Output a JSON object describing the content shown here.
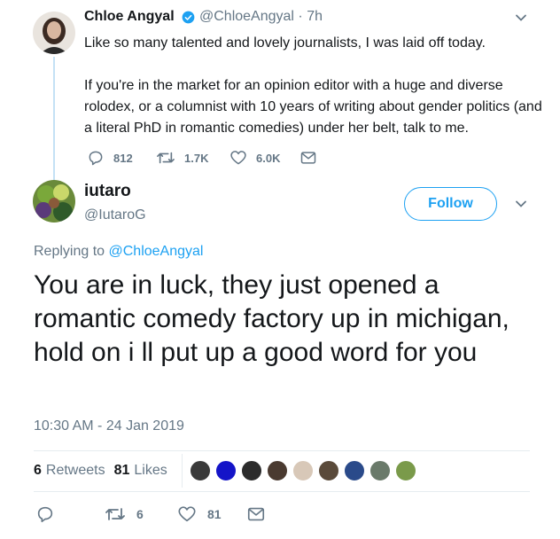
{
  "parent_tweet": {
    "author_name": "Chloe Angyal",
    "handle": "@ChloeAngyal",
    "separator": "·",
    "time": "7h",
    "paragraphs": [
      "Like so many talented and lovely journalists, I was laid off today.",
      "If you're in the market for an opinion editor with a huge and diverse rolodex, or a columnist with 10 years of writing about gender politics (and a literal PhD in romantic comedies) under her belt, talk to me."
    ],
    "actions": {
      "replies": "812",
      "retweets": "1.7K",
      "likes": "6.0K"
    }
  },
  "reply_tweet": {
    "author_name": "iutaro",
    "handle": "@IutaroG",
    "follow_label": "Follow",
    "replying_prefix": "Replying to",
    "replying_to": "@ChloeAngyal",
    "text": "You are in luck, they just opened a romantic comedy factory up in michigan, hold on i ll put up a good word for you",
    "timestamp": "10:30 AM - 24 Jan 2019",
    "stats": {
      "retweets_count": "6",
      "retweets_label": "Retweets",
      "likes_count": "81",
      "likes_label": "Likes"
    },
    "actions": {
      "retweets": "6",
      "likes": "81"
    }
  },
  "colors": {
    "accent": "#1da1f2",
    "muted": "#657786",
    "text": "#14171a"
  },
  "liker_avatar_colors": [
    "#3a3a3a",
    "#1414c8",
    "#2b2b2b",
    "#4a3a30",
    "#d8c8b8",
    "#5a4a3a",
    "#2a4a8a",
    "#6a7a6a",
    "#7a9a4a"
  ]
}
